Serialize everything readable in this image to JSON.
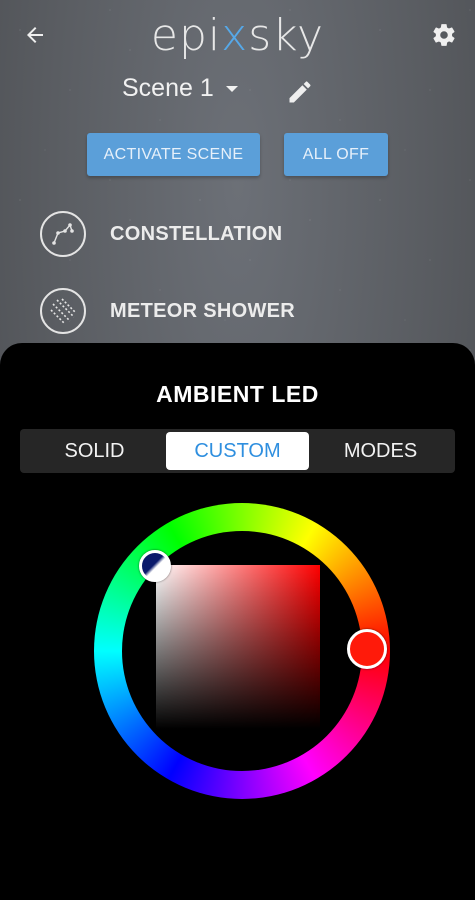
{
  "app": {
    "logo": {
      "prefix": "epi",
      "accent": "x",
      "suffix": "sky",
      "accent_color": "#56a8e8"
    }
  },
  "header": {
    "back_icon": "arrow-left-icon",
    "settings_icon": "gear-icon"
  },
  "scene": {
    "selected": "Scene 1",
    "edit_icon": "pencil-icon"
  },
  "actions": {
    "activate_label": "ACTIVATE SCENE",
    "all_off_label": "ALL OFF",
    "button_color": "#5b9fd9"
  },
  "effects": [
    {
      "label": "CONSTELLATION",
      "icon": "constellation-icon"
    },
    {
      "label": "METEOR SHOWER",
      "icon": "meteor-shower-icon"
    }
  ],
  "sheet": {
    "title": "AMBIENT LED",
    "tabs": [
      {
        "label": "SOLID",
        "active": false
      },
      {
        "label": "CUSTOM",
        "active": true
      },
      {
        "label": "MODES",
        "active": false
      }
    ],
    "active_tab_color": "#2f8fdf",
    "color_picker": {
      "selected_hue_color": "#ff1a0a"
    }
  }
}
